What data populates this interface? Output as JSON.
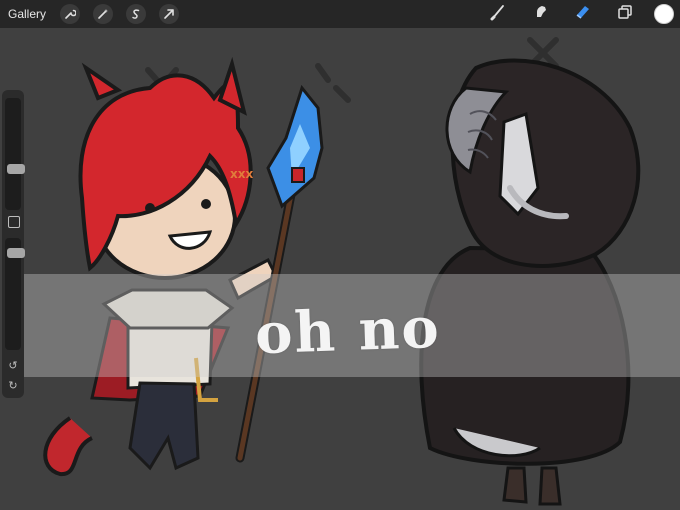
{
  "topbar": {
    "gallery_label": "Gallery",
    "left_tools": [
      "wrench-icon",
      "magic-wand-icon",
      "selection-icon",
      "transform-arrow-icon"
    ],
    "right_tools": [
      "brush-icon",
      "smudge-icon",
      "eraser-icon",
      "layers-icon"
    ],
    "current_color": "#ffffff"
  },
  "colors": {
    "toolbar_bg": "#262626",
    "canvas_bg": "#404040",
    "eraser_active": "#3b8ff0",
    "banner": "rgba(205,205,205,0.38)"
  },
  "canvas": {
    "banner_text": "oh no"
  }
}
